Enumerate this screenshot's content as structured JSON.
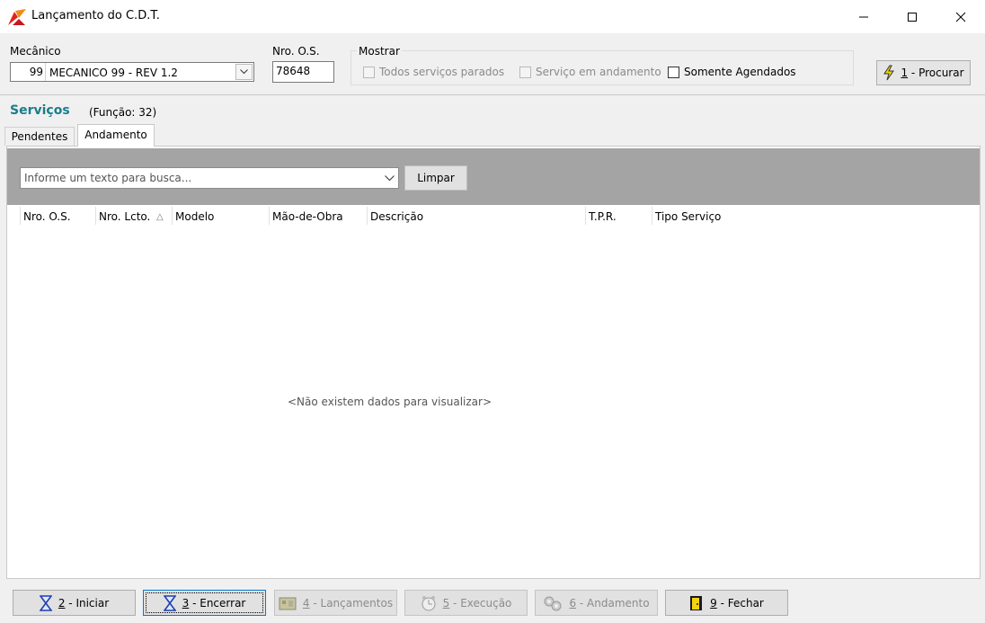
{
  "window": {
    "title": "Lançamento do C.D.T."
  },
  "filters": {
    "mecanico_label": "Mecânico",
    "mecanico_code": "99",
    "mecanico_name": "MECANICO 99 - REV 1.2",
    "os_label": "Nro. O.S.",
    "os_value": "78648",
    "mostrar_label": "Mostrar",
    "opt_parados": "Todos serviços parados",
    "opt_andamento": "Serviço em andamento",
    "opt_agendados": "Somente Agendados",
    "procurar_key": "1",
    "procurar_label": " - Procurar"
  },
  "section": {
    "title": "Serviços",
    "funcao": "(Função: 32)"
  },
  "tabs": {
    "pendentes": "Pendentes",
    "andamento": "Andamento"
  },
  "search": {
    "placeholder": "Informe um texto para busca...",
    "limpar": "Limpar"
  },
  "table": {
    "columns": [
      "Nro. O.S.",
      "Nro. Lcto.",
      "Modelo",
      "Mão-de-Obra",
      "Descrição",
      "T.P.R.",
      "Tipo Serviço"
    ],
    "sort_indicator": "△",
    "empty": "<Não existem dados para visualizar>"
  },
  "buttons": {
    "iniciar_key": "2",
    "iniciar": " - Iniciar",
    "encerrar_key": "3",
    "encerrar": " - Encerrar",
    "lancamentos_key": "4",
    "lancamentos": " - Lançamentos",
    "execucao_key": "5",
    "execucao": " - Execução",
    "andamento_key": "6",
    "andamento": " - Andamento",
    "fechar_key": "9",
    "fechar": " - Fechar"
  },
  "icons": {
    "app": "app-logo-icon",
    "min": "minimize-icon",
    "max": "maximize-icon",
    "close": "close-icon",
    "procurar": "lightning-icon",
    "iniciar": "hourglass-icon",
    "encerrar": "hourglass-icon",
    "lancamentos": "toolbox-icon",
    "execucao": "clock-icon",
    "andamento": "gears-icon",
    "fechar": "exit-door-icon"
  },
  "colors": {
    "accent": "#1a7d8c",
    "search_bar": "#a4a4a4",
    "focus": "#0078d7"
  }
}
